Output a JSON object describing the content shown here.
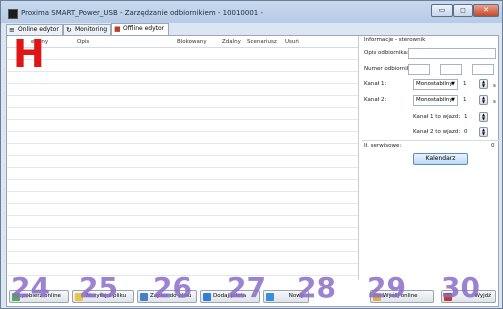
{
  "window": {
    "title": "Proxima SMART_Power_USB - Zarzędzanie odbiornikiem - 10010001 -",
    "controls": {
      "minimize": "▭",
      "maximize": "◻",
      "close": "✕"
    }
  },
  "tabs": [
    {
      "label": "Online edytor",
      "icon": "list-icon"
    },
    {
      "label": "Monitoring",
      "icon": "refresh-icon"
    },
    {
      "label": "Offline edytor",
      "icon": "offline-editor-icon"
    }
  ],
  "table": {
    "columns": [
      "eryjny",
      "Opis",
      "Blokowany",
      "Zdalny",
      "Scenariusz",
      "Usuń"
    ]
  },
  "info": {
    "heading": "Informacje - sterownik",
    "opis_label": "Opis odbiornika:",
    "opis_value": "",
    "numer_label": "Numer odbiornika:",
    "numer_values": [
      "",
      "",
      ""
    ],
    "kanal1_label": "Kanał 1:",
    "kanal1_mode": "Monostabilny",
    "kanal1_value": "1",
    "kanal1_unit": "s",
    "kanal2_label": "Kanał 2:",
    "kanal2_mode": "Monostabilny",
    "kanal2_value": "1",
    "kanal2_unit": "s",
    "k1_wejscie_label": "Kanał 1 to wjazd:",
    "k1_wejscie_value": "1",
    "k2_wejscie_label": "Kanał 2 to wjazd:",
    "k2_wejscie_value": "0",
    "il_serwisowe_label": "Ił. serwisowe:",
    "il_serwisowe_value": "0",
    "kalendarz_label": "Kalendarz"
  },
  "bottom_buttons": [
    {
      "label": "pobierz online",
      "icon": "download-icon"
    },
    {
      "label": "Wczytaj z pliku",
      "icon": "open-folder-icon"
    },
    {
      "label": "Zapisz do pliku",
      "icon": "save-icon"
    },
    {
      "label": "Dodaj pilota",
      "icon": "add-icon"
    },
    {
      "label": "Nowy",
      "icon": "new-icon"
    },
    {
      "label": "Wyślij online",
      "icon": "upload-icon"
    },
    {
      "label": "Wyjdź",
      "icon": "exit-icon"
    }
  ],
  "markers": {
    "h": "H",
    "numbers": [
      "24",
      "25",
      "26",
      "27",
      "28",
      "29",
      "30"
    ]
  },
  "colors": {
    "marker_number": "#8b6dc9",
    "marker_h": "#e01616",
    "accent_button": "#bcd9f2"
  }
}
